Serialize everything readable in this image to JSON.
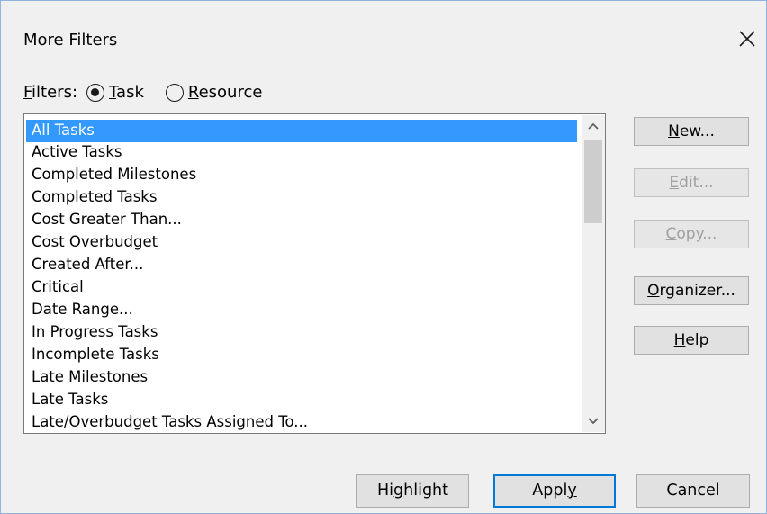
{
  "dialog": {
    "title": "More Filters",
    "close_icon": "close-icon"
  },
  "filters": {
    "label_accel": "F",
    "label_rest": "ilters:",
    "options": [
      {
        "pre": "",
        "accel": "T",
        "post": "ask",
        "selected": true
      },
      {
        "pre": "",
        "accel": "R",
        "post": "esource",
        "selected": false
      }
    ]
  },
  "filter_list": {
    "items": [
      "All Tasks",
      "Active Tasks",
      "Completed Milestones",
      "Completed Tasks",
      "Cost Greater Than...",
      "Cost Overbudget",
      "Created After...",
      "Critical",
      "Date Range...",
      "In Progress Tasks",
      "Incomplete Tasks",
      "Late Milestones",
      "Late Tasks",
      "Late/Overbudget Tasks Assigned To..."
    ],
    "selected_index": 0
  },
  "side_buttons": {
    "new": {
      "pre": "",
      "accel": "N",
      "post": "ew...",
      "enabled": true
    },
    "edit": {
      "pre": "",
      "accel": "E",
      "post": "dit...",
      "enabled": false
    },
    "copy": {
      "pre": "",
      "accel": "C",
      "post": "opy...",
      "enabled": false
    },
    "organizer": {
      "pre": "",
      "accel": "O",
      "post": "rganizer...",
      "enabled": true
    },
    "help": {
      "pre": "",
      "accel": "H",
      "post": "elp",
      "enabled": true
    }
  },
  "bottom_buttons": {
    "highlight": {
      "pre": "Hi",
      "accel": "g",
      "post": "hlight"
    },
    "apply": {
      "pre": "Appl",
      "accel": "y",
      "post": ""
    },
    "cancel": {
      "pre": "Cancel",
      "accel": "",
      "post": ""
    }
  },
  "colors": {
    "selection": "#3399ff",
    "default_button_border": "#0078d7",
    "disabled_text": "#a0a0a0"
  }
}
